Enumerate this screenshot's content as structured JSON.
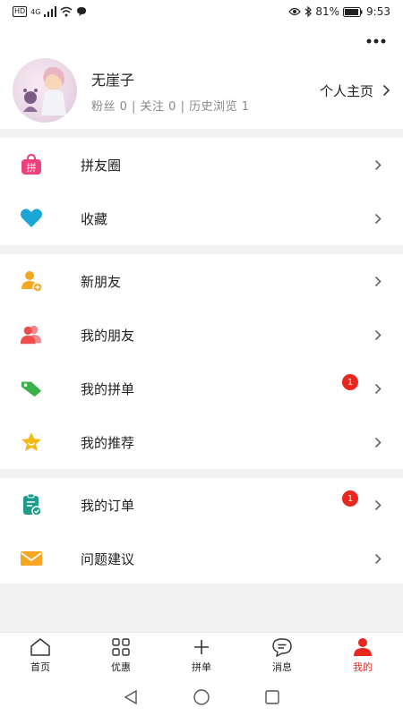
{
  "status_bar": {
    "hd": "HD",
    "network": "4G",
    "battery": "81%",
    "time": "9:53"
  },
  "profile": {
    "username": "无崖子",
    "stats": "粉丝 0 | 关注 0 | 历史浏览 1",
    "homepage_label": "个人主页"
  },
  "menu": {
    "group1": [
      {
        "label": "拼友圈",
        "icon": "pin-friend-circle-icon",
        "color": "#f0407a"
      },
      {
        "label": "收藏",
        "icon": "heart-icon",
        "color": "#1aa7d6"
      }
    ],
    "group2": [
      {
        "label": "新朋友",
        "icon": "add-friend-icon",
        "color": "#f5a623"
      },
      {
        "label": "我的朋友",
        "icon": "friends-icon",
        "color": "#ef4c4c"
      },
      {
        "label": "我的拼单",
        "icon": "tag-icon",
        "color": "#3bb14a",
        "badge": "1"
      },
      {
        "label": "我的推荐",
        "icon": "star-icon",
        "color": "#f6b80f"
      }
    ],
    "group3": [
      {
        "label": "我的订单",
        "icon": "order-clipboard-icon",
        "color": "#1e9c8a",
        "badge": "1"
      },
      {
        "label": "问题建议",
        "icon": "mail-icon",
        "color": "#f5a623"
      }
    ]
  },
  "tab_bar": {
    "tabs": [
      {
        "label": "首页",
        "icon": "home-icon"
      },
      {
        "label": "优惠",
        "icon": "grid-icon"
      },
      {
        "label": "拼单",
        "icon": "plus-icon"
      },
      {
        "label": "消息",
        "icon": "message-icon"
      },
      {
        "label": "我的",
        "icon": "user-icon",
        "active": true
      }
    ],
    "active_color": "#e8271f"
  }
}
